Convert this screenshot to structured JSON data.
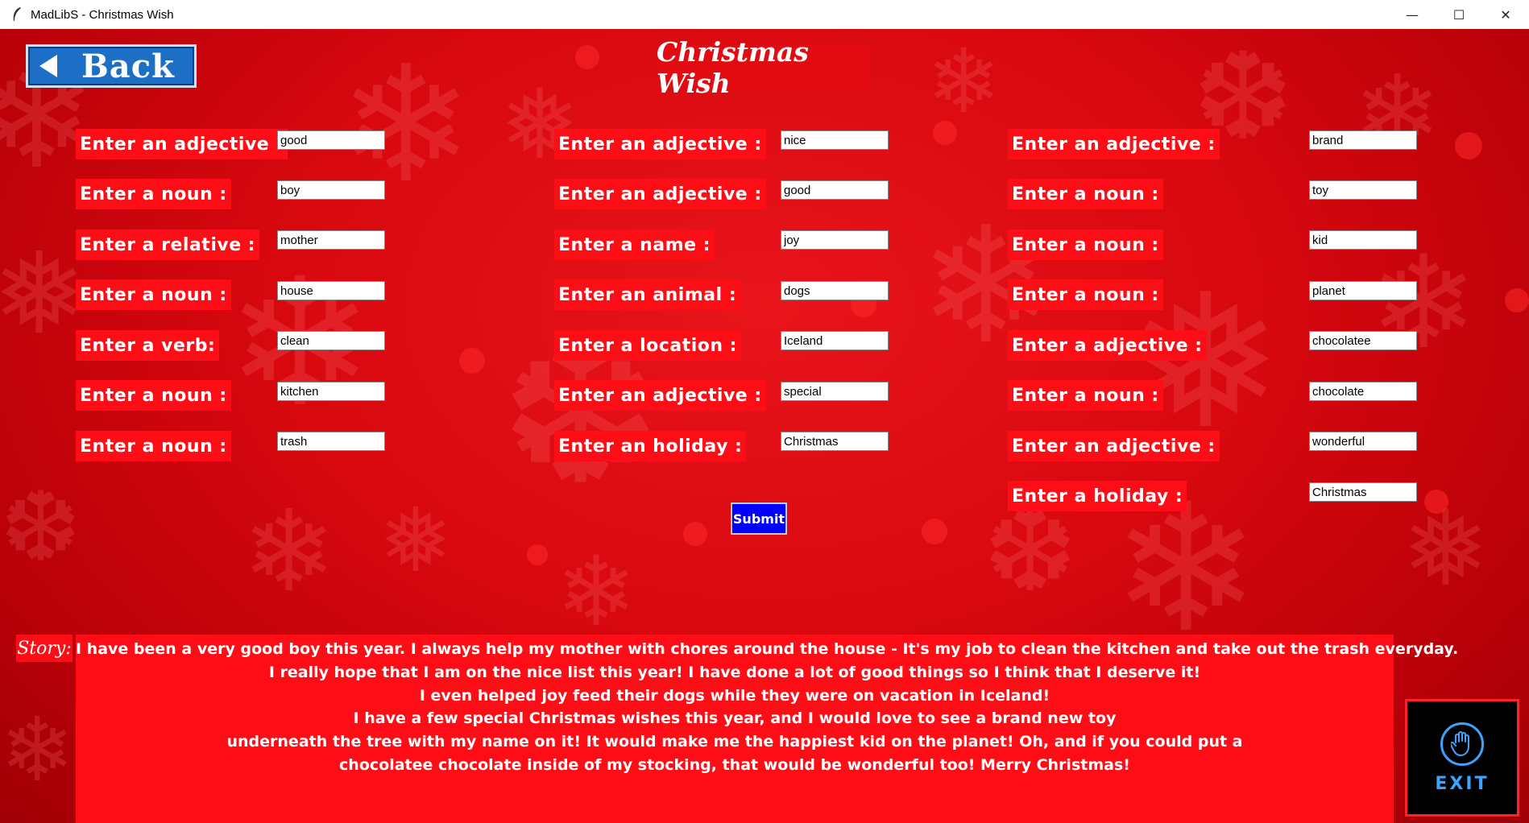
{
  "window": {
    "title": "MadLibS - Christmas Wish",
    "minimize_glyph": "—",
    "maximize_glyph": "☐",
    "close_glyph": "✕",
    "icon": "feather-icon"
  },
  "header": {
    "back_label": "Back",
    "title": "Christmas Wish"
  },
  "form": {
    "col1": [
      {
        "label": "Enter an adjective :",
        "value": "good"
      },
      {
        "label": "Enter a noun :",
        "value": "boy"
      },
      {
        "label": "Enter a relative :",
        "value": "mother"
      },
      {
        "label": "Enter a noun :",
        "value": "house"
      },
      {
        "label": "Enter a verb:",
        "value": "clean"
      },
      {
        "label": "Enter a noun :",
        "value": "kitchen"
      },
      {
        "label": "Enter a noun :",
        "value": "trash"
      }
    ],
    "col2": [
      {
        "label": "Enter an adjective :",
        "value": "nice"
      },
      {
        "label": "Enter an adjective :",
        "value": "good"
      },
      {
        "label": "Enter a name :",
        "value": "joy"
      },
      {
        "label": "Enter an animal :",
        "value": "dogs"
      },
      {
        "label": "Enter a location :",
        "value": "Iceland"
      },
      {
        "label": "Enter an adjective :",
        "value": "special"
      },
      {
        "label": "Enter an holiday :",
        "value": "Christmas"
      }
    ],
    "col3": [
      {
        "label": "Enter an adjective :",
        "value": "brand"
      },
      {
        "label": "Enter a noun :",
        "value": "toy"
      },
      {
        "label": "Enter a noun :",
        "value": "kid"
      },
      {
        "label": "Enter a noun :",
        "value": "planet"
      },
      {
        "label": "Enter a adjective :",
        "value": "chocolatee"
      },
      {
        "label": "Enter a noun :",
        "value": "chocolate"
      },
      {
        "label": "Enter an adjective :",
        "value": "wonderful"
      },
      {
        "label": "Enter a holiday :",
        "value": "Christmas"
      }
    ],
    "submit_label": "Submit"
  },
  "story": {
    "label": "Story:",
    "lines": [
      "I have been a very good boy this year. I always help my mother with chores around the house - It's my job to clean the kitchen and take out the trash everyday.",
      "I really hope that I am on the nice list this year! I have done a lot of good things so I think that I deserve it!",
      "I even helped joy feed their dogs while they were on vacation in Iceland!",
      "I have a few special Christmas wishes this year, and I would love to see a brand new toy",
      "underneath the tree with my name on it! It would make me the happiest kid on the planet! Oh, and if you could put a",
      "chocolatee chocolate inside of my stocking, that would be wonderful too! Merry Christmas!"
    ]
  },
  "exit": {
    "label": "EXIT",
    "icon": "hand-stop-icon"
  },
  "colors": {
    "background": "#d8080f",
    "label_bg": "#ff0d16",
    "back_button": "#1c6fc4",
    "submit_button": "#0000ff",
    "exit_accent": "#3aa4ff"
  }
}
